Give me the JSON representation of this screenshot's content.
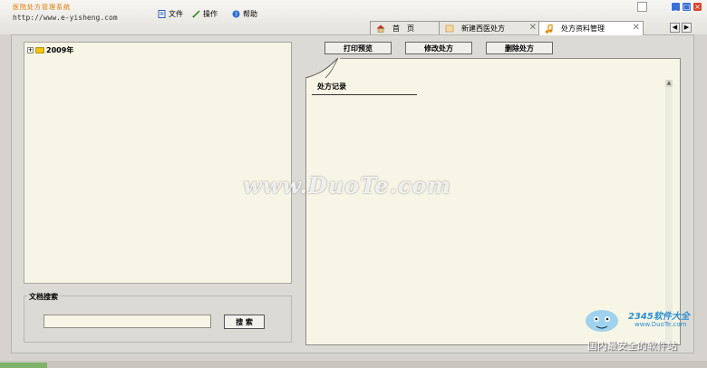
{
  "header": {
    "logo_text": "医院处方管理系统",
    "url": "http://www.e-yisheng.com"
  },
  "menu": [
    {
      "label": "文件",
      "icon": "document-icon"
    },
    {
      "label": "操作",
      "icon": "pencil-icon"
    },
    {
      "label": "帮助",
      "icon": "help-icon"
    }
  ],
  "tabs": [
    {
      "label": "首　页",
      "icon": "home-icon"
    },
    {
      "label": "新建西医处方",
      "icon": "prescription-icon"
    },
    {
      "label": "处方资料管理",
      "icon": "music-note-icon",
      "active": true
    }
  ],
  "tree": {
    "root_label": "2009年",
    "expander": "+"
  },
  "search": {
    "group_title": "文档搜索",
    "input_value": "",
    "button_label": "搜 索"
  },
  "toolbar": {
    "print_label": "打印预览",
    "edit_label": "修改处方",
    "delete_label": "删除处方"
  },
  "document": {
    "title": "处方记录"
  },
  "watermark": {
    "text": "www.DuoTe.com"
  },
  "badge": {
    "brand": "2345软件大全",
    "url": "www.DuoTe.com",
    "slogan": "国内最安全的软件站"
  },
  "colors": {
    "accent": "#3a6fd8",
    "close": "#d9442c",
    "panel": "#f7f6e6",
    "badge": "#2c8fd0"
  }
}
